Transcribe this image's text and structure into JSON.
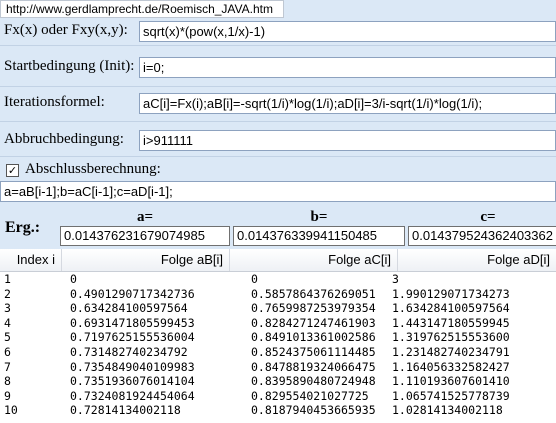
{
  "url": "http://www.gerdlamprecht.de/Roemisch_JAVA.htm",
  "form": {
    "fx_label": "Fx(x) oder Fxy(x,y):",
    "fx_value": "sqrt(x)*(pow(x,1/x)-1)",
    "init_label": "Startbedingung (Init):",
    "init_value": "i=0;",
    "iter_label": "Iterationsformel:",
    "iter_value": "aC[i]=Fx(i);aB[i]=-sqrt(1/i)*log(1/i);aD[i]=3/i-sqrt(1/i)*log(1/i);",
    "abbruch_label": "Abbruchbedingung:",
    "abbruch_value": "i>911111",
    "abschluss_label": "Abschlussberechnung:",
    "abschluss_checked": true,
    "abschluss_value": "a=aB[i-1];b=aC[i-1];c=aD[i-1];"
  },
  "results": {
    "erg_label": "Erg.:",
    "a_label": "a=",
    "a_value": "0.014376231679074985",
    "b_label": "b=",
    "b_value": "0.014376339941150485",
    "c_label": "c=",
    "c_value": "0.014379524362403362"
  },
  "table": {
    "headers": [
      "Index i",
      "Folge aB[i]",
      "Folge aC[i]",
      "Folge aD[i]"
    ],
    "rows": [
      [
        "1",
        "0",
        "0",
        "3"
      ],
      [
        "2",
        "0.4901290717342736",
        "0.5857864376269051",
        "1.990129071734273"
      ],
      [
        "3",
        "0.634284100597564",
        "0.7659987253979354",
        "1.634284100597564"
      ],
      [
        "4",
        "0.6931471805599453",
        "0.8284271247461903",
        "1.443147180559945"
      ],
      [
        "5",
        "0.7197625155536004",
        "0.8491013361002586",
        "1.319762515553600"
      ],
      [
        "6",
        "0.731482740234792",
        "0.8524375061114485",
        "1.231482740234791"
      ],
      [
        "7",
        "0.7354849040109983",
        "0.8478819324066475",
        "1.164056332582427"
      ],
      [
        "8",
        "0.7351936076014104",
        "0.8395890480724948",
        "1.110193607601410"
      ],
      [
        "9",
        "0.7324081924454064",
        "0.829554021027725",
        "1.065741525778739"
      ],
      [
        "10",
        "0.72814134002118",
        "0.8187940453665935",
        "1.02814134002118"
      ]
    ]
  }
}
